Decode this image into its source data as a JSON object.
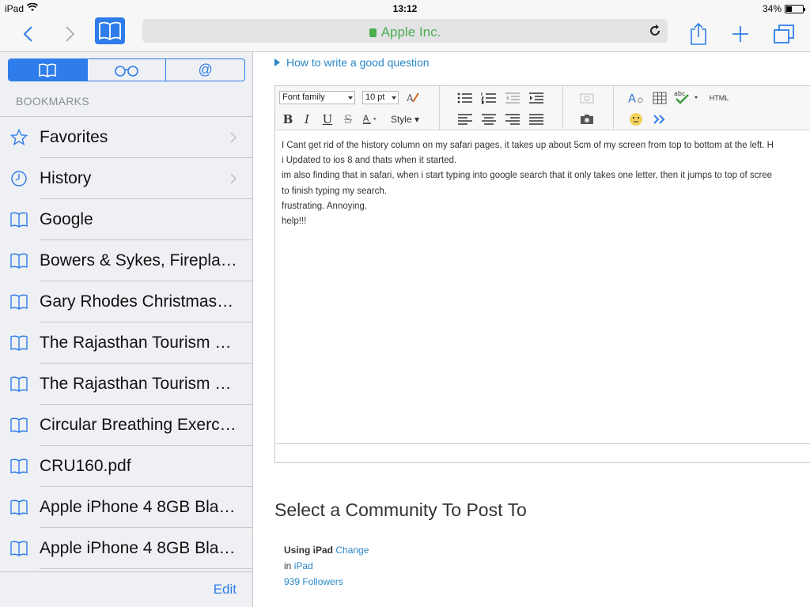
{
  "status_bar": {
    "device": "iPad",
    "time": "13:12",
    "battery": "34%",
    "battery_level": 0.34
  },
  "toolbar": {
    "url": "Apple Inc."
  },
  "sidebar": {
    "segments": [
      "book-icon",
      "glasses-icon",
      "@"
    ],
    "header": "BOOKMARKS",
    "items": [
      {
        "label": "Favorites",
        "icon": "star-icon",
        "chevron": true
      },
      {
        "label": "History",
        "icon": "clock-icon",
        "chevron": true
      },
      {
        "label": "Google",
        "icon": "book-icon"
      },
      {
        "label": "Bowers & Sykes, Firepla…",
        "icon": "book-icon"
      },
      {
        "label": "Gary Rhodes Christmas…",
        "icon": "book-icon"
      },
      {
        "label": "The Rajasthan Tourism E…",
        "icon": "book-icon"
      },
      {
        "label": "The Rajasthan Tourism E…",
        "icon": "book-icon"
      },
      {
        "label": "Circular Breathing Exerci…",
        "icon": "book-icon"
      },
      {
        "label": "CRU160.pdf",
        "icon": "book-icon"
      },
      {
        "label": "Apple iPhone 4 8GB Bla…",
        "icon": "book-icon"
      },
      {
        "label": "Apple iPhone 4 8GB Bla…",
        "icon": "book-icon"
      }
    ],
    "edit_label": "Edit"
  },
  "main": {
    "howto_link": "How to write a good question",
    "editor": {
      "font_family": "Font family",
      "font_size": "10 pt",
      "style_label": "Style",
      "html_label": "HTML",
      "lines": [
        "I Cant get rid of the history column on my safari pages, it takes up about 5cm of my screen from top to bottom at the left. H",
        "i Updated to ios 8 and thats when it started.",
        "im also finding that in safari, when i start typing into google search that it only takes one letter, then it jumps to top of scree",
        "to finish typing my search.",
        "frustrating. Annoying.",
        "help!!!"
      ]
    },
    "community_title": "Select a Community To Post To",
    "using_label": "Using iPad",
    "change_link": "Change",
    "in_label": "in",
    "community_link": "iPad",
    "followers": "939 Followers"
  },
  "colors": {
    "accent": "#2f7dea",
    "link": "#2a87c8",
    "secure": "#4cae4f"
  }
}
